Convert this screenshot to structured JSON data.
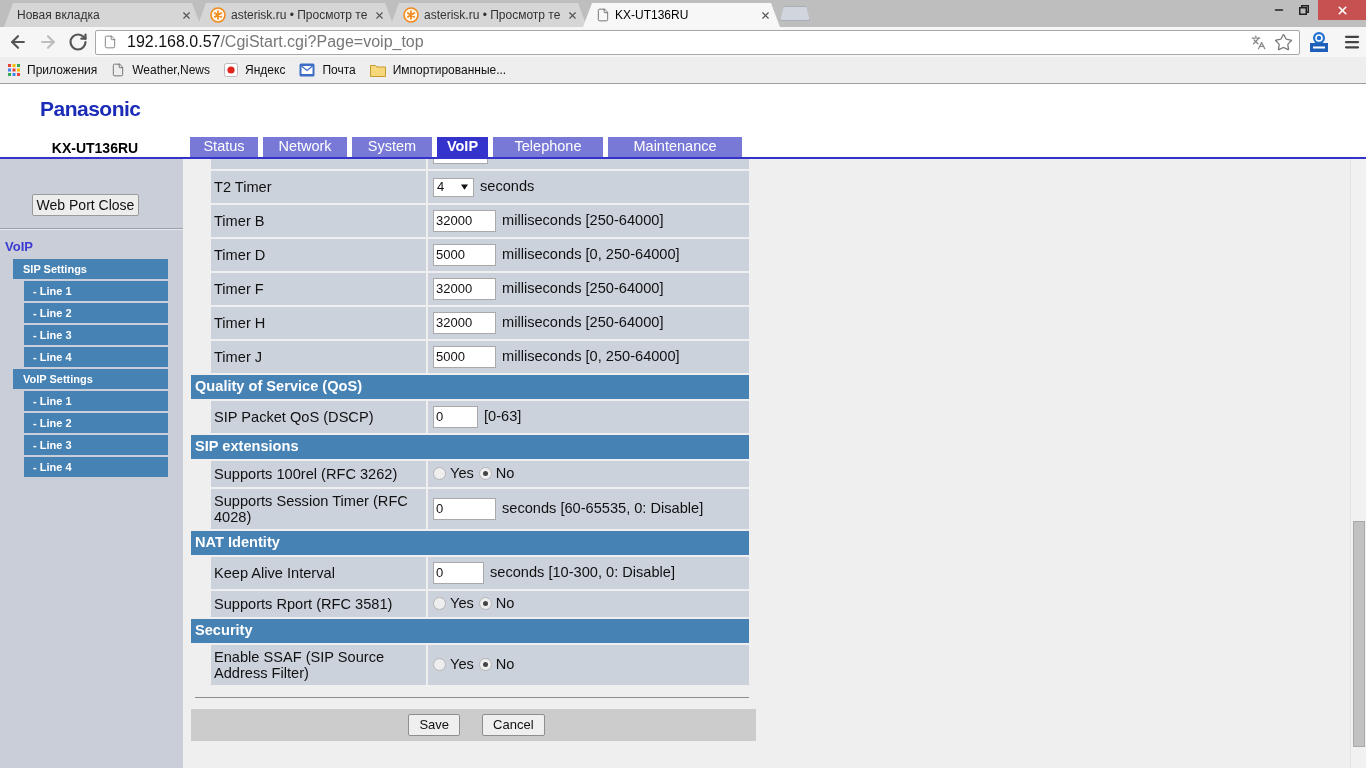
{
  "browser": {
    "tabs": [
      {
        "kind": "blank",
        "title": "Новая вкладка",
        "selected": false
      },
      {
        "kind": "site",
        "title": "asterisk.ru • Просмотр те",
        "selected": false
      },
      {
        "kind": "site",
        "title": "asterisk.ru • Просмотр те",
        "selected": false
      },
      {
        "kind": "page",
        "title": "KX-UT136RU",
        "selected": true
      }
    ],
    "nav_buttons": [
      {
        "kind": "back",
        "disabled": false
      },
      {
        "kind": "forward",
        "disabled": true
      },
      {
        "kind": "reload",
        "disabled": false
      }
    ],
    "address": {
      "host": "192.168.0.57",
      "path": "/CgiStart.cgi?Page=voip_top"
    },
    "bookmarks": [
      {
        "kind": "apps",
        "label": "Приложения"
      },
      {
        "kind": "page",
        "label": "Weather,News"
      },
      {
        "kind": "yandex",
        "label": "Яндекс"
      },
      {
        "kind": "mail",
        "label": "Почта"
      },
      {
        "kind": "folder",
        "label": "Импортированные..."
      }
    ]
  },
  "header": {
    "logo": "Panasonic",
    "model": "KX-UT136RU"
  },
  "nav_tabs": [
    {
      "label": "Status",
      "selected": false
    },
    {
      "label": "Network",
      "selected": false
    },
    {
      "label": "System",
      "selected": false
    },
    {
      "label": "VoIP",
      "selected": true
    },
    {
      "label": "Telephone",
      "selected": false
    },
    {
      "label": "Maintenance",
      "selected": false
    }
  ],
  "sidebar": {
    "button": "Web Port Close",
    "title": "VoIP",
    "items": [
      {
        "label": "SIP Settings",
        "children": [
          {
            "label": "- Line 1"
          },
          {
            "label": "- Line 2"
          },
          {
            "label": "- Line 3"
          },
          {
            "label": "- Line 4"
          }
        ]
      },
      {
        "label": "VoIP Settings",
        "children": [
          {
            "label": "- Line 1"
          },
          {
            "label": "- Line 2"
          },
          {
            "label": "- Line 3"
          },
          {
            "label": "- Line 4"
          }
        ]
      }
    ]
  },
  "form": {
    "rows": [
      {
        "kind": "cut_off"
      },
      {
        "kind": "select",
        "label": "T2 Timer",
        "value": "4",
        "unit": "seconds"
      },
      {
        "kind": "input",
        "label": "Timer B",
        "value": "32000",
        "unit": "milliseconds [250-64000]"
      },
      {
        "kind": "input",
        "label": "Timer D",
        "value": "5000",
        "unit": "milliseconds [0, 250-64000]"
      },
      {
        "kind": "input",
        "label": "Timer F",
        "value": "32000",
        "unit": "milliseconds [250-64000]"
      },
      {
        "kind": "input",
        "label": "Timer H",
        "value": "32000",
        "unit": "milliseconds [250-64000]"
      },
      {
        "kind": "input",
        "label": "Timer J",
        "value": "5000",
        "unit": "milliseconds [0, 250-64000]"
      },
      {
        "kind": "section",
        "title": "Quality of Service (QoS)"
      },
      {
        "kind": "input",
        "label": "SIP Packet QoS (DSCP)",
        "value": "0",
        "unit": "[0-63]"
      },
      {
        "kind": "section",
        "title": "SIP extensions"
      },
      {
        "kind": "radio",
        "label": "Supports 100rel (RFC 3262)",
        "options": [
          {
            "label": "Yes",
            "selected": false
          },
          {
            "label": "No",
            "selected": true
          }
        ]
      },
      {
        "kind": "input",
        "label": "Supports Session Timer (RFC 4028)",
        "value": "0",
        "unit": "seconds [60-65535, 0: Disable]"
      },
      {
        "kind": "section",
        "title": "NAT Identity"
      },
      {
        "kind": "input",
        "label": "Keep Alive Interval",
        "value": "0",
        "unit": "seconds [10-300, 0: Disable]"
      },
      {
        "kind": "radio",
        "label": "Supports Rport (RFC 3581)",
        "options": [
          {
            "label": "Yes",
            "selected": false
          },
          {
            "label": "No",
            "selected": true
          }
        ]
      },
      {
        "kind": "section",
        "title": "Security"
      },
      {
        "kind": "radio",
        "label": "Enable SSAF (SIP Source Address Filter)",
        "options": [
          {
            "label": "Yes",
            "selected": false
          },
          {
            "label": "No",
            "selected": true
          }
        ]
      }
    ],
    "buttons": [
      "Save",
      "Cancel"
    ]
  }
}
